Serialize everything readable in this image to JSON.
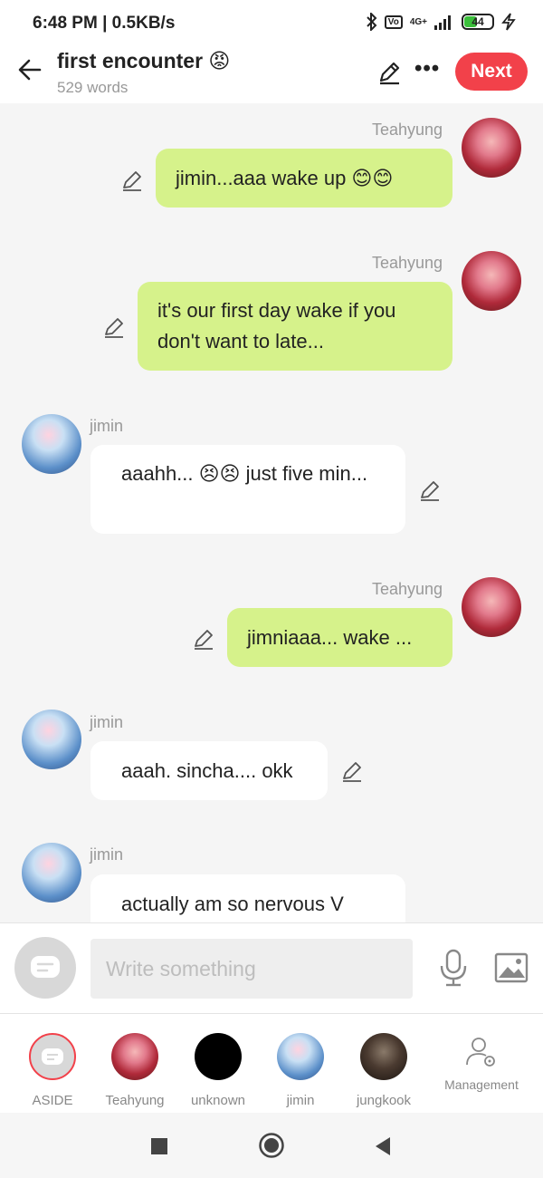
{
  "status": {
    "time": "6:48 PM | 0.5KB/s",
    "signal": "4G+",
    "battery": "44"
  },
  "header": {
    "title": "first encounter 😡",
    "word_count": "529 words",
    "next_label": "Next"
  },
  "messages": [
    {
      "speaker": "Teahyung",
      "text": "jimin...aaa wake up 😊😊",
      "side": "right"
    },
    {
      "speaker": "Teahyung",
      "text": "it's our first day wake if you don't want to late...",
      "side": "right"
    },
    {
      "speaker": "jimin",
      "text": "aaahh... 😣😣 just five min...",
      "side": "left"
    },
    {
      "speaker": "Teahyung",
      "text": "jimniaaa... wake ...",
      "side": "right"
    },
    {
      "speaker": "jimin",
      "text": "aaah. sincha....  okk",
      "side": "left"
    },
    {
      "speaker": "jimin",
      "text": "actually am so nervous V",
      "side": "left"
    }
  ],
  "composer": {
    "placeholder": "Write something"
  },
  "characters": [
    {
      "label": "ASIDE"
    },
    {
      "label": "Teahyung"
    },
    {
      "label": "unknown"
    },
    {
      "label": "jimin"
    },
    {
      "label": "jungkook"
    },
    {
      "label": "Management"
    }
  ],
  "colors": {
    "accent": "#f2414a",
    "bubble_green": "#d6f28b",
    "bubble_white": "#ffffff",
    "background": "#f5f5f5"
  },
  "icons": [
    "arrow-left-icon",
    "pencil-icon",
    "more-icon",
    "chat-icon",
    "mic-icon",
    "image-icon",
    "person-gear-icon",
    "square-icon",
    "circle-icon",
    "triangle-back-icon"
  ]
}
